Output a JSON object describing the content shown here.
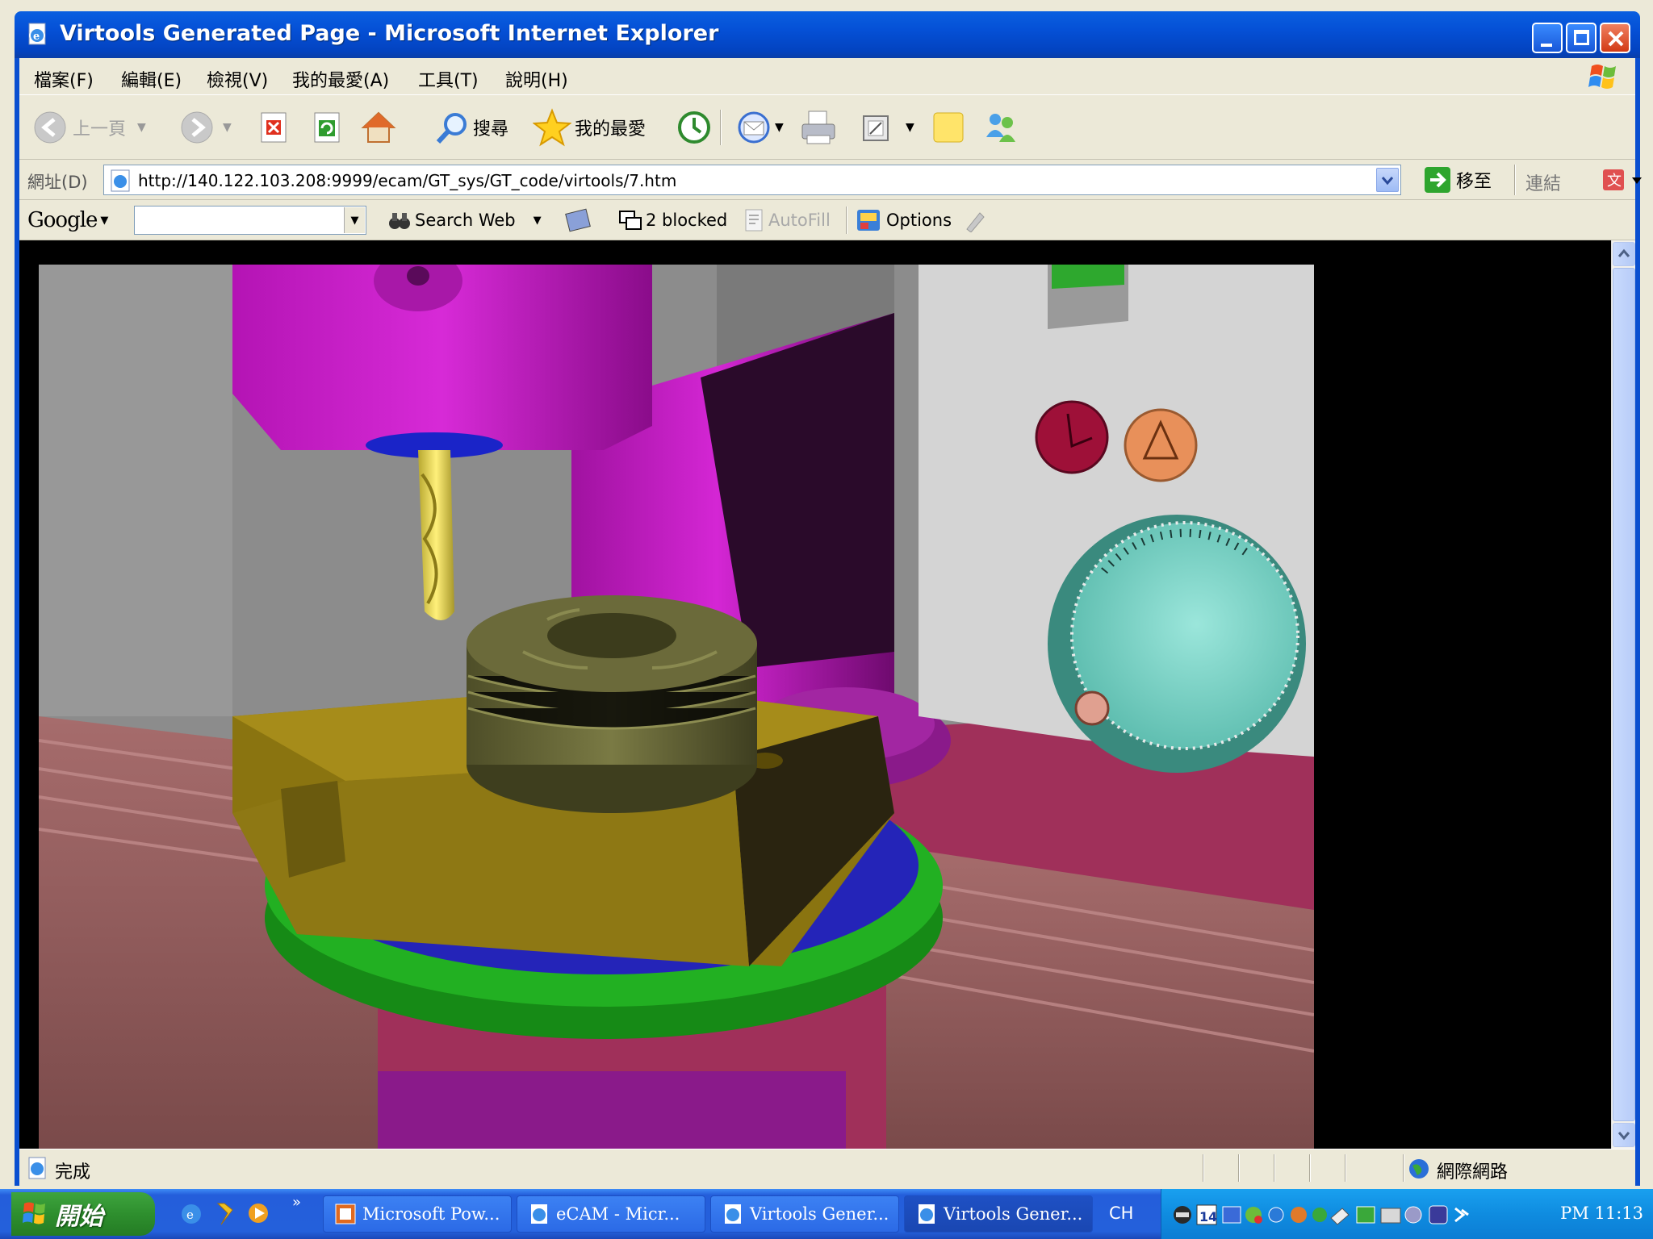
{
  "window": {
    "title": "Virtools Generated Page - Microsoft Internet Explorer"
  },
  "menu": [
    "檔案(F)",
    "編輯(E)",
    "檢視(V)",
    "我的最愛(A)",
    "工具(T)",
    "說明(H)"
  ],
  "toolbar": {
    "back_label": "上一頁",
    "search_label": "搜尋",
    "favorites_label": "我的最愛"
  },
  "address": {
    "label": "網址(D)",
    "url": "http://140.122.103.208:9999/ecam/GT_sys/GT_code/virtools/7.htm",
    "go_label": "移至",
    "links_label": "連結"
  },
  "google_bar": {
    "logo": "Google",
    "search_web_label": "Search Web",
    "blocked_label": "2 blocked",
    "autofill_label": "AutoFill",
    "options_label": "Options"
  },
  "status": {
    "text": "完成",
    "zone": "網際網路"
  },
  "taskbar": {
    "start_label": "開始",
    "tasks": [
      "Microsoft Pow...",
      "eCAM - Micr...",
      "Virtools Gener...",
      "Virtools Gener..."
    ],
    "lang": "CH",
    "tray_badge": "14",
    "clock": "PM 11:13"
  },
  "colors": {
    "titlebar": "#0550d6",
    "machine_head": "#c81ec8",
    "workpiece": "#6b6a3a",
    "vise": "#8a7410",
    "table": "#8c5a5a",
    "rotary_ring": "#1a9e1a",
    "rotary_base": "#2020b8",
    "handwheel": "#7fd6c9"
  }
}
